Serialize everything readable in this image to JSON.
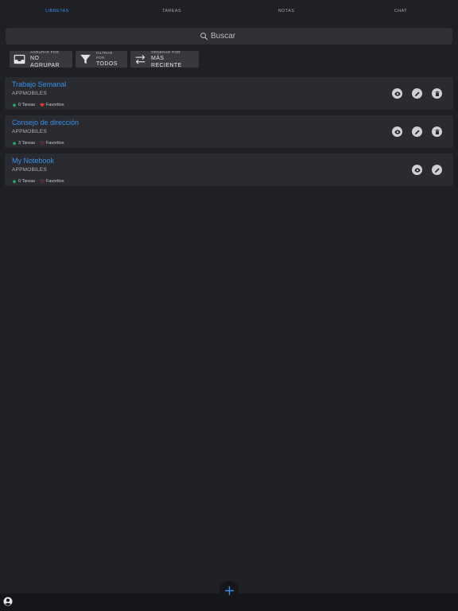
{
  "tabs": [
    {
      "label": "LIBRETAS",
      "active": true
    },
    {
      "label": "TAREAS",
      "active": false
    },
    {
      "label": "NOTAS",
      "active": false
    },
    {
      "label": "CHAT",
      "active": false
    }
  ],
  "search": {
    "placeholder": "Buscar",
    "icon": "search-icon"
  },
  "filters": [
    {
      "small": "AGRUPAR POR",
      "big": "NO AGRUPAR",
      "icon": "inbox-icon"
    },
    {
      "small": "FILTRAR POR",
      "big": "TODOS",
      "icon": "filter-icon"
    },
    {
      "small": "ORDENAR POR",
      "big": "MÁS RECIENTE",
      "icon": "swap-icon"
    }
  ],
  "notebooks": [
    {
      "title": "Trabajo Semanal",
      "owner": "APPMOBILES",
      "tasks": "0 Tareas",
      "favorites": "Favoritos",
      "favorite_filled": true,
      "can_delete": true
    },
    {
      "title": "Consejo de dirección",
      "owner": "APPMOBILES",
      "tasks": "3 Tareas",
      "favorites": "Favoritos",
      "favorite_filled": false,
      "can_delete": true
    },
    {
      "title": "My Notebook",
      "owner": "APPMOBILES",
      "tasks": "0 Tareas",
      "favorites": "Favoritos",
      "favorite_filled": false,
      "can_delete": false
    }
  ],
  "colors": {
    "accent": "#3b8ee8",
    "star": "#2fb36b",
    "heart": "#e53935",
    "background": "#1f2024",
    "card": "#2a2b30"
  }
}
